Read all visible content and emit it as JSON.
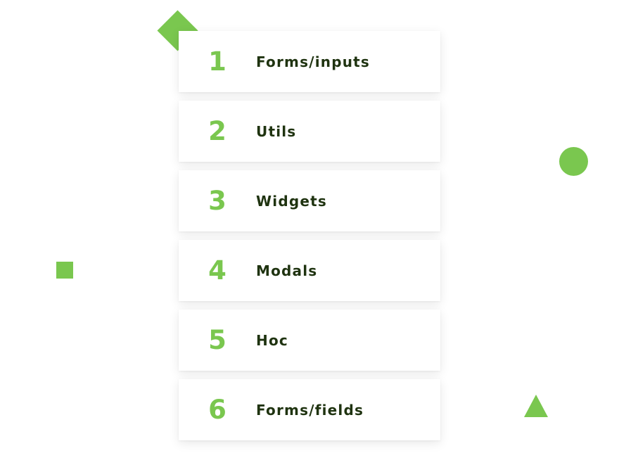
{
  "accent_color": "#7ac74f",
  "text_color": "#1f3310",
  "decorations": [
    "diamond",
    "circle",
    "square",
    "triangle"
  ],
  "items": [
    {
      "number": "1",
      "label": "Forms/inputs"
    },
    {
      "number": "2",
      "label": "Utils"
    },
    {
      "number": "3",
      "label": "Widgets"
    },
    {
      "number": "4",
      "label": "Modals"
    },
    {
      "number": "5",
      "label": "Hoc"
    },
    {
      "number": "6",
      "label": "Forms/fields"
    }
  ]
}
